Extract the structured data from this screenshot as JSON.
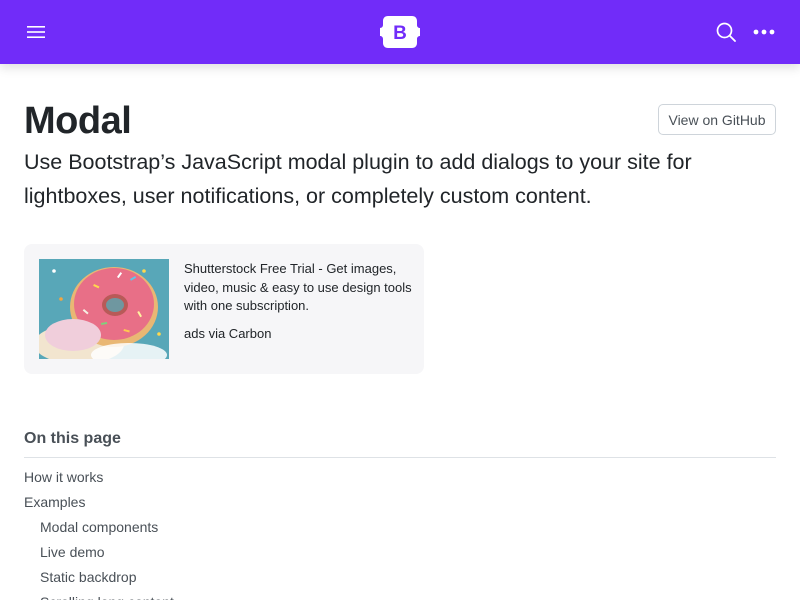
{
  "navbar": {
    "background": "#712cf9",
    "brand_letter": "B",
    "icons": [
      "menu-icon",
      "search-icon",
      "more-icon"
    ]
  },
  "page": {
    "title": "Modal",
    "github_button": "View on GitHub",
    "lead": "Use Bootstrap’s JavaScript modal plugin to add dialogs to your site for lightboxes, user notifications, or completely custom content."
  },
  "ad": {
    "text": "Shutterstock Free Trial - Get images, video, music & easy to use design tools with one subscription.",
    "via": "ads via Carbon"
  },
  "toc": {
    "title": "On this page",
    "items": [
      {
        "label": "How it works",
        "level": 1
      },
      {
        "label": "Examples",
        "level": 1
      },
      {
        "label": "Modal components",
        "level": 2
      },
      {
        "label": "Live demo",
        "level": 2
      },
      {
        "label": "Static backdrop",
        "level": 2
      },
      {
        "label": "Scrolling long content",
        "level": 2
      }
    ]
  }
}
